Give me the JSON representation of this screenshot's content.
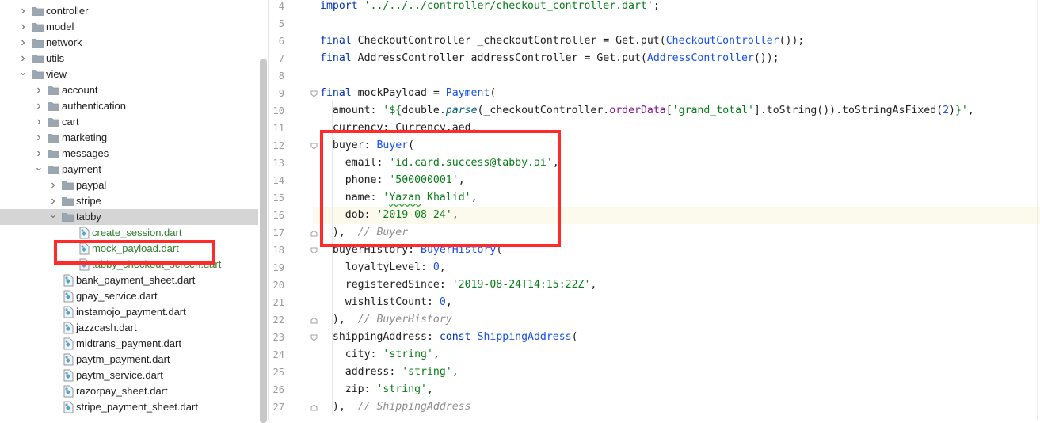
{
  "project_tree": {
    "items": [
      {
        "label": "controller",
        "type": "folder",
        "depth": 1,
        "expanded": false
      },
      {
        "label": "model",
        "type": "folder",
        "depth": 1,
        "expanded": false
      },
      {
        "label": "network",
        "type": "folder",
        "depth": 1,
        "expanded": false
      },
      {
        "label": "utils",
        "type": "folder",
        "depth": 1,
        "expanded": false
      },
      {
        "label": "view",
        "type": "folder",
        "depth": 1,
        "expanded": true
      },
      {
        "label": "account",
        "type": "folder",
        "depth": 2,
        "expanded": false
      },
      {
        "label": "authentication",
        "type": "folder",
        "depth": 2,
        "expanded": false
      },
      {
        "label": "cart",
        "type": "folder",
        "depth": 2,
        "expanded": false
      },
      {
        "label": "marketing",
        "type": "folder",
        "depth": 2,
        "expanded": false
      },
      {
        "label": "messages",
        "type": "folder",
        "depth": 2,
        "expanded": false
      },
      {
        "label": "payment",
        "type": "folder",
        "depth": 2,
        "expanded": true
      },
      {
        "label": "paypal",
        "type": "folder",
        "depth": 3,
        "expanded": false
      },
      {
        "label": "stripe",
        "type": "folder",
        "depth": 3,
        "expanded": false
      },
      {
        "label": "tabby",
        "type": "folder",
        "depth": 3,
        "expanded": true,
        "selected": true
      },
      {
        "label": "create_session.dart",
        "type": "file",
        "depth": 4,
        "vcs": "added"
      },
      {
        "label": "mock_payload.dart",
        "type": "file",
        "depth": 4,
        "vcs": "added"
      },
      {
        "label": "tabby_checkout_screen.dart",
        "type": "file",
        "depth": 4,
        "vcs": "added"
      },
      {
        "label": "bank_payment_sheet.dart",
        "type": "file",
        "depth": 3
      },
      {
        "label": "gpay_service.dart",
        "type": "file",
        "depth": 3
      },
      {
        "label": "instamojo_payment.dart",
        "type": "file",
        "depth": 3
      },
      {
        "label": "jazzcash.dart",
        "type": "file",
        "depth": 3
      },
      {
        "label": "midtrans_payment.dart",
        "type": "file",
        "depth": 3
      },
      {
        "label": "paytm_payment.dart",
        "type": "file",
        "depth": 3
      },
      {
        "label": "paytm_service.dart",
        "type": "file",
        "depth": 3
      },
      {
        "label": "razorpay_sheet.dart",
        "type": "file",
        "depth": 3
      },
      {
        "label": "stripe_payment_sheet.dart",
        "type": "file",
        "depth": 3
      }
    ]
  },
  "editor": {
    "current_line": 16,
    "lines": [
      {
        "n": "4",
        "tokens": [
          [
            "kw",
            "import "
          ],
          [
            "str",
            "'../../../controller/checkout_controller.dart'"
          ],
          [
            "",
            "; "
          ]
        ]
      },
      {
        "n": "5",
        "tokens": []
      },
      {
        "n": "6",
        "tokens": [
          [
            "kw",
            "final "
          ],
          [
            "",
            "CheckoutController _checkoutController = Get.put("
          ],
          [
            "cls",
            "CheckoutController"
          ],
          [
            "",
            "());"
          ]
        ]
      },
      {
        "n": "7",
        "tokens": [
          [
            "kw",
            "final "
          ],
          [
            "",
            "AddressController addressController = Get.put("
          ],
          [
            "cls",
            "AddressController"
          ],
          [
            "",
            "());"
          ]
        ]
      },
      {
        "n": "8",
        "tokens": []
      },
      {
        "n": "9",
        "tokens": [
          [
            "kw",
            "final "
          ],
          [
            "",
            "mockPayload = "
          ],
          [
            "cls",
            "Payment"
          ],
          [
            "",
            "("
          ]
        ]
      },
      {
        "n": "10",
        "tokens": [
          [
            "",
            "  amount: "
          ],
          [
            "str",
            "'${"
          ],
          [
            "",
            "double."
          ],
          [
            "fn",
            "parse"
          ],
          [
            "",
            "(_checkoutController."
          ],
          [
            "mth",
            "orderData"
          ],
          [
            "",
            "["
          ],
          [
            "str",
            "'grand_total'"
          ],
          [
            "",
            "].toString()).toStringAsFixed("
          ],
          [
            "num",
            "2"
          ],
          [
            "",
            ")"
          ],
          [
            "str",
            "}'"
          ],
          [
            "",
            ","
          ]
        ]
      },
      {
        "n": "11",
        "tokens": [
          [
            "",
            "  currency: Currency.aed,"
          ]
        ]
      },
      {
        "n": "12",
        "tokens": [
          [
            "",
            "  buyer: "
          ],
          [
            "cls",
            "Buyer"
          ],
          [
            "",
            "("
          ]
        ]
      },
      {
        "n": "13",
        "tokens": [
          [
            "",
            "    email: "
          ],
          [
            "str",
            "'id.card.success@tabby.ai'"
          ],
          [
            "",
            ","
          ]
        ]
      },
      {
        "n": "14",
        "tokens": [
          [
            "",
            "    phone: "
          ],
          [
            "str",
            "'500000001'"
          ],
          [
            "",
            ","
          ]
        ]
      },
      {
        "n": "15",
        "tokens": [
          [
            "",
            "    name: "
          ],
          [
            "str",
            "'"
          ],
          [
            "str squig",
            "Yazan"
          ],
          [
            "str",
            " Khalid'"
          ],
          [
            "",
            ","
          ]
        ]
      },
      {
        "n": "16",
        "tokens": [
          [
            "",
            "    dob: "
          ],
          [
            "str",
            "'2019-08-24'"
          ],
          [
            "",
            ","
          ]
        ]
      },
      {
        "n": "17",
        "tokens": [
          [
            "",
            "  ),  "
          ],
          [
            "cmt",
            "// Buyer"
          ]
        ]
      },
      {
        "n": "18",
        "tokens": [
          [
            "",
            "  buyerHistory: "
          ],
          [
            "cls",
            "BuyerHistory"
          ],
          [
            "",
            "("
          ]
        ]
      },
      {
        "n": "19",
        "tokens": [
          [
            "",
            "    loyaltyLevel: "
          ],
          [
            "num",
            "0"
          ],
          [
            "",
            ","
          ]
        ]
      },
      {
        "n": "20",
        "tokens": [
          [
            "",
            "    registeredSince: "
          ],
          [
            "str",
            "'2019-08-24T14:15:22Z'"
          ],
          [
            "",
            ","
          ]
        ]
      },
      {
        "n": "21",
        "tokens": [
          [
            "",
            "    wishlistCount: "
          ],
          [
            "num",
            "0"
          ],
          [
            "",
            ","
          ]
        ]
      },
      {
        "n": "22",
        "tokens": [
          [
            "",
            "  ),  "
          ],
          [
            "cmt",
            "// BuyerHistory"
          ]
        ]
      },
      {
        "n": "23",
        "tokens": [
          [
            "",
            "  shippingAddress: "
          ],
          [
            "kw",
            "const "
          ],
          [
            "cls",
            "ShippingAddress"
          ],
          [
            "",
            "("
          ]
        ]
      },
      {
        "n": "24",
        "tokens": [
          [
            "",
            "    city: "
          ],
          [
            "str",
            "'string'"
          ],
          [
            "",
            ","
          ]
        ]
      },
      {
        "n": "25",
        "tokens": [
          [
            "",
            "    address: "
          ],
          [
            "str",
            "'string'"
          ],
          [
            "",
            ","
          ]
        ]
      },
      {
        "n": "26",
        "tokens": [
          [
            "",
            "    zip: "
          ],
          [
            "str",
            "'string'"
          ],
          [
            "",
            ","
          ]
        ]
      },
      {
        "n": "27",
        "tokens": [
          [
            "",
            "  ),  "
          ],
          [
            "cmt",
            "// ShippingAddress"
          ]
        ]
      }
    ]
  },
  "colors": {
    "highlight_box": "#ff2a2a",
    "selected_row": "#d5d5d5",
    "vcs_added": "#2c7d2c",
    "keyword": "#0033b3",
    "string": "#067d17",
    "comment": "#8c8c8c"
  },
  "icons": {
    "folder": "folder-icon",
    "file": "dart-file-icon",
    "expand": "chevron-icon"
  }
}
